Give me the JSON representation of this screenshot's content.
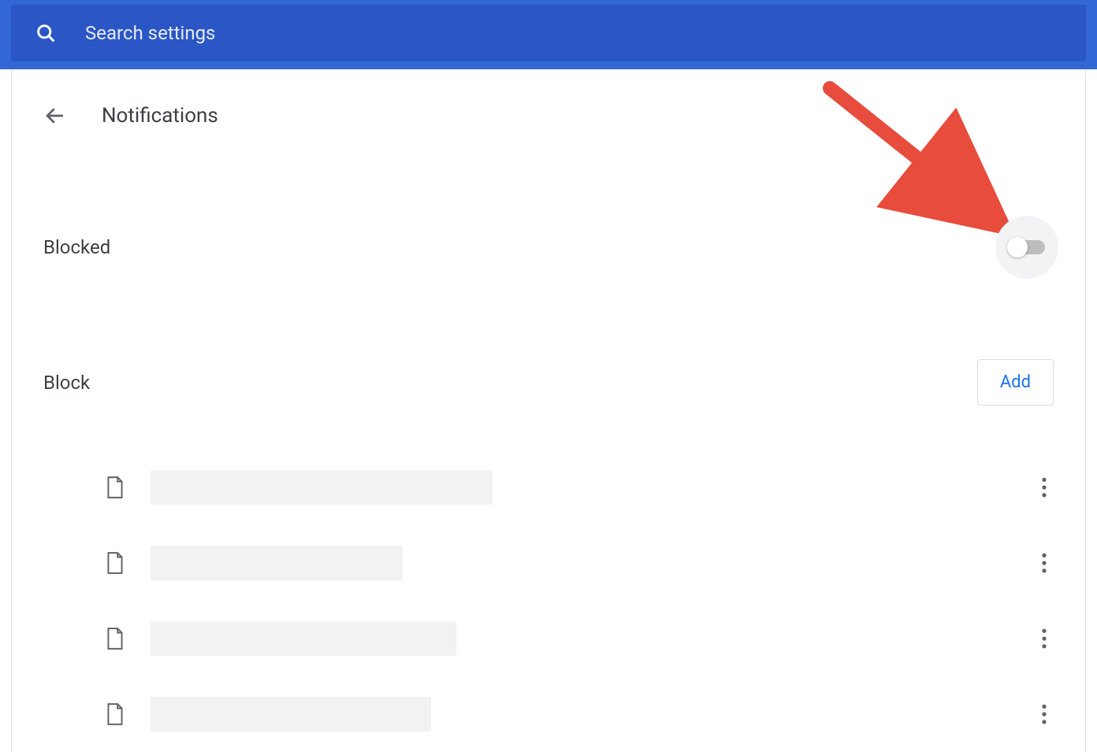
{
  "search": {
    "placeholder": "Search settings"
  },
  "page": {
    "title": "Notifications"
  },
  "blocked": {
    "label": "Blocked",
    "toggle_state": "off"
  },
  "block_section": {
    "label": "Block",
    "add_button": "Add"
  },
  "list_items": [
    {
      "redacted_width": 434
    },
    {
      "redacted_width": 320
    },
    {
      "redacted_width": 388
    },
    {
      "redacted_width": 356
    }
  ],
  "annotation": {
    "type": "arrow",
    "color": "#e74c3c",
    "points_to": "blocked-toggle"
  }
}
